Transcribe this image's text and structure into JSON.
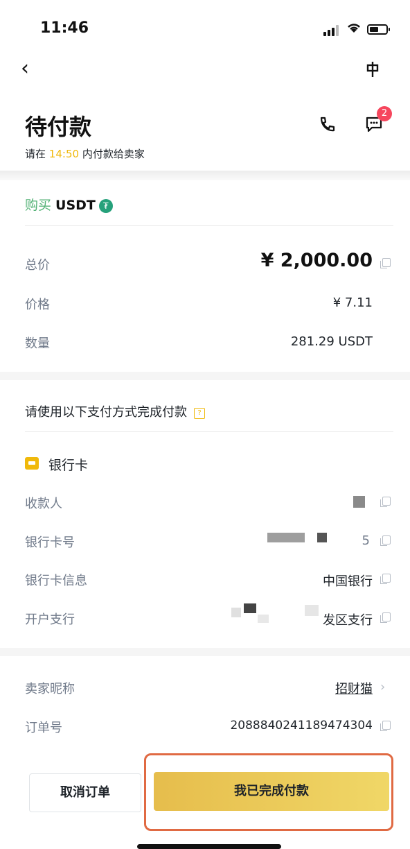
{
  "status_bar": {
    "time": "11:46"
  },
  "header": {
    "title": "待付款",
    "subtitle_prefix": "请在",
    "countdown": "14:50",
    "subtitle_suffix": "内付款给卖家",
    "chat_badge": "2"
  },
  "order": {
    "action_label": "购买",
    "coin": "USDT",
    "total_label": "总价",
    "total_value": "¥ 2,000.00",
    "price_label": "价格",
    "price_value": "¥ 7.11",
    "quantity_label": "数量",
    "quantity_value": "281.29 USDT"
  },
  "payment": {
    "section_title": "请使用以下支付方式完成付款",
    "method_label": "银行卡",
    "fields": [
      {
        "label": "收款人",
        "value": ""
      },
      {
        "label": "银行卡号",
        "value": "5"
      },
      {
        "label": "银行卡信息",
        "value": "中国银行"
      },
      {
        "label": "开户支行",
        "value": "发区支行"
      }
    ]
  },
  "seller": {
    "nickname_label": "卖家昵称",
    "nickname_value": "招财猫",
    "order_no_label": "订单号",
    "order_no_value": "20888402411894743​04"
  },
  "actions": {
    "cancel_label": "取消订单",
    "confirm_label": "我已完成付款"
  },
  "colors": {
    "accent": "#f0b90b",
    "buy_green": "#54b276",
    "badge_red": "#f6465d",
    "highlight_border": "#e06a43"
  },
  "icons": [
    "back-icon",
    "pin-icon",
    "phone-icon",
    "chat-icon",
    "tether-icon",
    "copy-icon",
    "help-icon",
    "bank-card-icon",
    "chevron-right-icon"
  ]
}
